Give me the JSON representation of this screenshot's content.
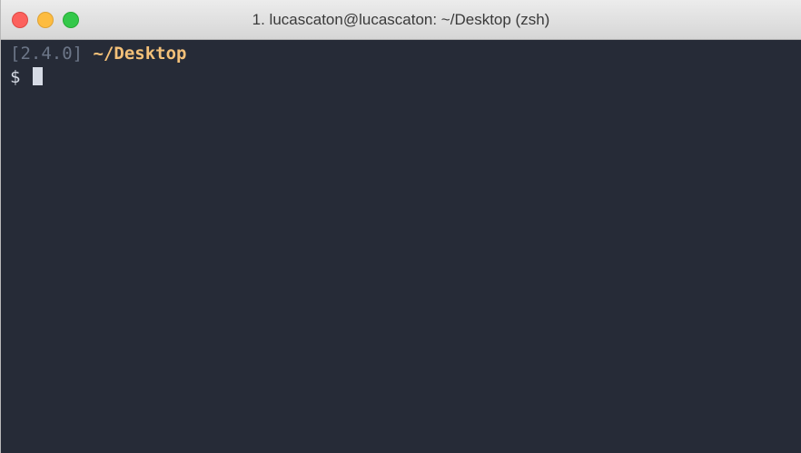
{
  "window": {
    "title": "1. lucascaton@lucascaton: ~/Desktop (zsh)",
    "controls": {
      "close_color": "#fc615d",
      "minimize_color": "#fdbc40",
      "zoom_color": "#34c84a"
    }
  },
  "terminal": {
    "background": "#262b37",
    "line1": {
      "version": "[2.4.0]",
      "path": "~/Desktop"
    },
    "line2": {
      "prompt": "$"
    }
  }
}
